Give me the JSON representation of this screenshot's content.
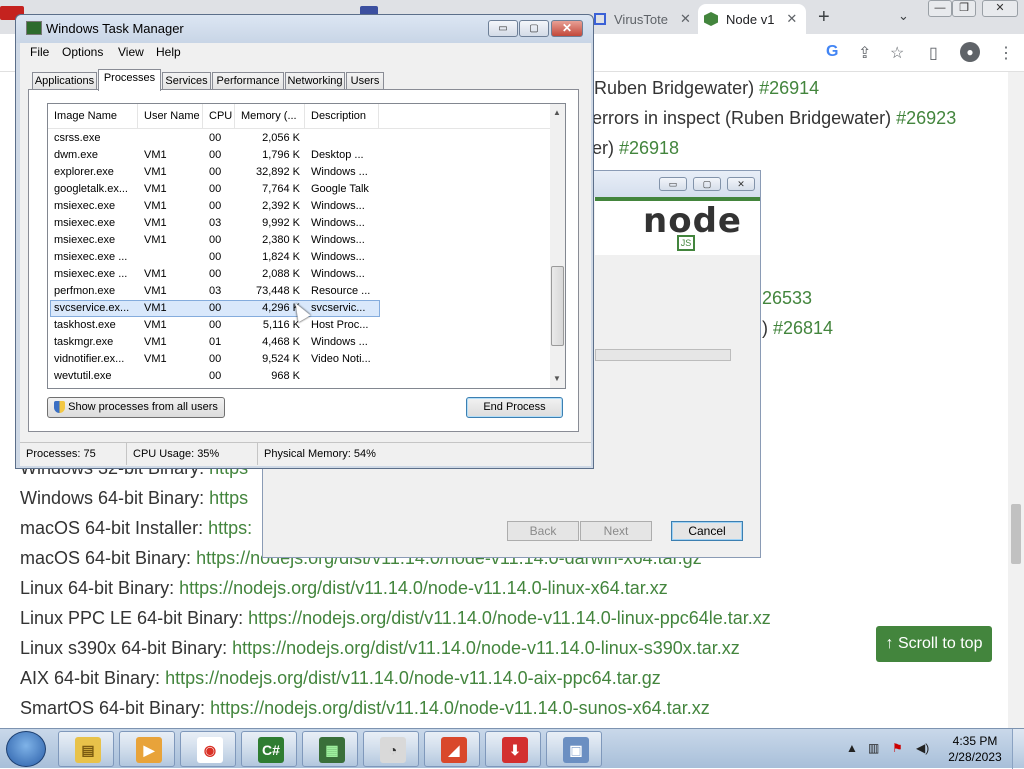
{
  "browser": {
    "tabs": [
      {
        "label": "VirusTote",
        "close": "✕"
      },
      {
        "label": "Node v1",
        "close": "✕"
      }
    ],
    "newtab": "+",
    "tabsearch": "⌄",
    "window_buttons": [
      "—",
      "❐",
      "✕"
    ]
  },
  "page": {
    "lines": [
      {
        "prefix": "Ruben Bridgewater) ",
        "link": "#26914"
      },
      {
        "prefix": "errors in inspect (Ruben Bridgewater) ",
        "link": "#26923"
      },
      {
        "prefix": "er) ",
        "link": "#26918"
      },
      {
        "prefix": "",
        "link": "26533"
      },
      {
        "prefix": ") ",
        "link": "#26814"
      }
    ],
    "binaries": [
      {
        "label": "Windows 32-bit Binary: ",
        "url": "https"
      },
      {
        "label": "Windows 64-bit Binary: ",
        "url": "https"
      },
      {
        "label": "macOS 64-bit Installer: ",
        "url": "https:"
      },
      {
        "label": "macOS 64-bit Binary: ",
        "url": "https://nodejs.org/dist/v11.14.0/node-v11.14.0-darwin-x64.tar.gz"
      },
      {
        "label": "Linux 64-bit Binary: ",
        "url": "https://nodejs.org/dist/v11.14.0/node-v11.14.0-linux-x64.tar.xz"
      },
      {
        "label": "Linux PPC LE 64-bit Binary: ",
        "url": "https://nodejs.org/dist/v11.14.0/node-v11.14.0-linux-ppc64le.tar.xz"
      },
      {
        "label": "Linux s390x 64-bit Binary: ",
        "url": "https://nodejs.org/dist/v11.14.0/node-v11.14.0-linux-s390x.tar.xz"
      },
      {
        "label": "AIX 64-bit Binary: ",
        "url": "https://nodejs.org/dist/v11.14.0/node-v11.14.0-aix-ppc64.tar.gz"
      },
      {
        "label": "SmartOS 64-bit Binary: ",
        "url": "https://nodejs.org/dist/v11.14.0/node-v11.14.0-sunos-x64.tar.xz"
      }
    ],
    "scroll_to_top": "↑ Scroll to top"
  },
  "installer": {
    "logo": "node",
    "logo_badge": "JS",
    "buttons": {
      "back": "Back",
      "next": "Next",
      "cancel": "Cancel"
    },
    "window_buttons": [
      "▭",
      "▢",
      "✕"
    ]
  },
  "taskmgr": {
    "title": "Windows Task Manager",
    "window_buttons": [
      "▭",
      "▢",
      "✕"
    ],
    "menu": [
      "File",
      "Options",
      "View",
      "Help"
    ],
    "tabs": [
      "Applications",
      "Processes",
      "Services",
      "Performance",
      "Networking",
      "Users"
    ],
    "active_tab": "Processes",
    "columns": [
      "Image Name",
      "User Name",
      "CPU",
      "Memory (...",
      "Description"
    ],
    "rows": [
      {
        "name": "csrss.exe",
        "user": "",
        "cpu": "00",
        "mem": "2,056 K",
        "desc": ""
      },
      {
        "name": "dwm.exe",
        "user": "VM1",
        "cpu": "00",
        "mem": "1,796 K",
        "desc": "Desktop ..."
      },
      {
        "name": "explorer.exe",
        "user": "VM1",
        "cpu": "00",
        "mem": "32,892 K",
        "desc": "Windows ..."
      },
      {
        "name": "googletalk.ex...",
        "user": "VM1",
        "cpu": "00",
        "mem": "7,764 K",
        "desc": "Google Talk"
      },
      {
        "name": "msiexec.exe",
        "user": "VM1",
        "cpu": "00",
        "mem": "2,392 K",
        "desc": "Windows..."
      },
      {
        "name": "msiexec.exe",
        "user": "VM1",
        "cpu": "03",
        "mem": "9,992 K",
        "desc": "Windows..."
      },
      {
        "name": "msiexec.exe",
        "user": "VM1",
        "cpu": "00",
        "mem": "2,380 K",
        "desc": "Windows..."
      },
      {
        "name": "msiexec.exe ...",
        "user": "",
        "cpu": "00",
        "mem": "1,824 K",
        "desc": "Windows..."
      },
      {
        "name": "msiexec.exe ...",
        "user": "VM1",
        "cpu": "00",
        "mem": "2,088 K",
        "desc": "Windows..."
      },
      {
        "name": "perfmon.exe",
        "user": "VM1",
        "cpu": "03",
        "mem": "73,448 K",
        "desc": "Resource ..."
      },
      {
        "name": "svcservice.ex...",
        "user": "VM1",
        "cpu": "00",
        "mem": "4,296 K",
        "desc": "svcservic...",
        "selected": true
      },
      {
        "name": "taskhost.exe",
        "user": "VM1",
        "cpu": "00",
        "mem": "5,116 K",
        "desc": "Host Proc..."
      },
      {
        "name": "taskmgr.exe",
        "user": "VM1",
        "cpu": "01",
        "mem": "4,468 K",
        "desc": "Windows ..."
      },
      {
        "name": "vidnotifier.ex...",
        "user": "VM1",
        "cpu": "00",
        "mem": "9,524 K",
        "desc": "Video Noti..."
      },
      {
        "name": "wevtutil.exe",
        "user": "",
        "cpu": "00",
        "mem": "968 K",
        "desc": ""
      }
    ],
    "show_all_button": "Show processes from all users",
    "end_process_button": "End Process",
    "status": {
      "processes": "Processes: 75",
      "cpu": "CPU Usage: 35%",
      "memory": "Physical Memory: 54%"
    }
  },
  "taskbar": {
    "apps": [
      {
        "icon": "folder-icon",
        "glyph": "▤"
      },
      {
        "icon": "media-player-icon",
        "glyph": "▶"
      },
      {
        "icon": "chrome-icon",
        "glyph": "◉"
      },
      {
        "icon": "csharp-icon",
        "glyph": "C#"
      },
      {
        "icon": "task-manager-icon",
        "glyph": "▦"
      },
      {
        "icon": "gauge-icon",
        "glyph": "◔"
      },
      {
        "icon": "eraser-icon",
        "glyph": "◢"
      },
      {
        "icon": "download-icon",
        "glyph": "⬇"
      },
      {
        "icon": "installer-icon",
        "glyph": "▣"
      }
    ],
    "clock_time": "4:35 PM",
    "clock_date": "2/28/2023"
  }
}
